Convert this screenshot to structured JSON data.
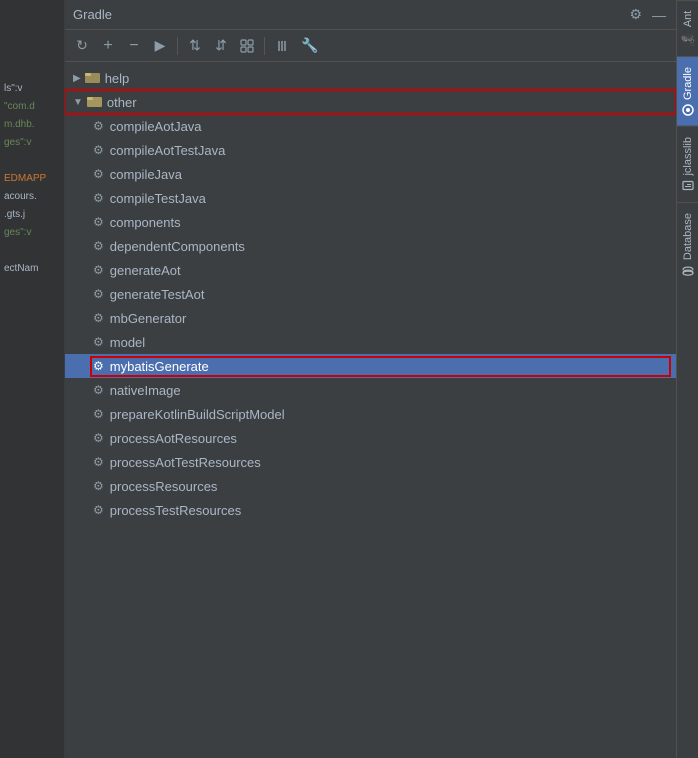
{
  "header": {
    "title": "Gradle",
    "settings_icon": "⚙",
    "minimize_icon": "—"
  },
  "toolbar": {
    "icons": [
      {
        "name": "refresh",
        "symbol": "↻"
      },
      {
        "name": "add",
        "symbol": "+"
      },
      {
        "name": "remove",
        "symbol": "−"
      },
      {
        "name": "run",
        "symbol": "▶"
      },
      {
        "name": "expand-all",
        "symbol": "⇅"
      },
      {
        "name": "collapse-all",
        "symbol": "⇵"
      },
      {
        "name": "group",
        "symbol": "⊞"
      },
      {
        "name": "link",
        "symbol": "⋮⋮"
      },
      {
        "name": "wrench",
        "symbol": "🔧"
      }
    ]
  },
  "tree": {
    "items": [
      {
        "id": "help",
        "label": "help",
        "type": "folder",
        "level": 0,
        "expanded": false,
        "arrow": "▶"
      },
      {
        "id": "other",
        "label": "other",
        "type": "folder",
        "level": 0,
        "expanded": true,
        "arrow": "▼",
        "outlined": true
      },
      {
        "id": "compileAotJava",
        "label": "compileAotJava",
        "type": "task",
        "level": 1
      },
      {
        "id": "compileAotTestJava",
        "label": "compileAotTestJava",
        "type": "task",
        "level": 1
      },
      {
        "id": "compileJava",
        "label": "compileJava",
        "type": "task",
        "level": 1
      },
      {
        "id": "compileTestJava",
        "label": "compileTestJava",
        "type": "task",
        "level": 1
      },
      {
        "id": "components",
        "label": "components",
        "type": "task",
        "level": 1
      },
      {
        "id": "dependentComponents",
        "label": "dependentComponents",
        "type": "task",
        "level": 1
      },
      {
        "id": "generateAot",
        "label": "generateAot",
        "type": "task",
        "level": 1
      },
      {
        "id": "generateTestAot",
        "label": "generateTestAot",
        "type": "task",
        "level": 1
      },
      {
        "id": "mbGenerator",
        "label": "mbGenerator",
        "type": "task",
        "level": 1
      },
      {
        "id": "model",
        "label": "model",
        "type": "task",
        "level": 1
      },
      {
        "id": "mybatisGenerate",
        "label": "mybatisGenerate",
        "type": "task",
        "level": 1,
        "selected": true,
        "outlined": true
      },
      {
        "id": "nativeImage",
        "label": "nativeImage",
        "type": "task",
        "level": 1
      },
      {
        "id": "prepareKotlinBuildScriptModel",
        "label": "prepareKotlinBuildScriptModel",
        "type": "task",
        "level": 1
      },
      {
        "id": "processAotResources",
        "label": "processAotResources",
        "type": "task",
        "level": 1
      },
      {
        "id": "processAotTestResources",
        "label": "processAotTestResources",
        "type": "task",
        "level": 1
      },
      {
        "id": "processResources",
        "label": "processResources",
        "type": "task",
        "level": 1
      },
      {
        "id": "processTestResources",
        "label": "processTestResources",
        "type": "task",
        "level": 1
      }
    ]
  },
  "sidebar_tabs": [
    {
      "id": "ant",
      "label": "Ant",
      "active": false
    },
    {
      "id": "gradle",
      "label": "Gradle",
      "active": true
    },
    {
      "id": "jclasslib",
      "label": "jclasslib",
      "active": false
    },
    {
      "id": "database",
      "label": "Database",
      "active": false
    }
  ],
  "editor": {
    "lines": [
      "ls\":v",
      "\"com.d",
      "m.dhb.",
      "ges\":v",
      "",
      "EDMAPP",
      "acours.",
      ".gts.j",
      "ges\":v",
      "",
      "ectNam"
    ]
  }
}
